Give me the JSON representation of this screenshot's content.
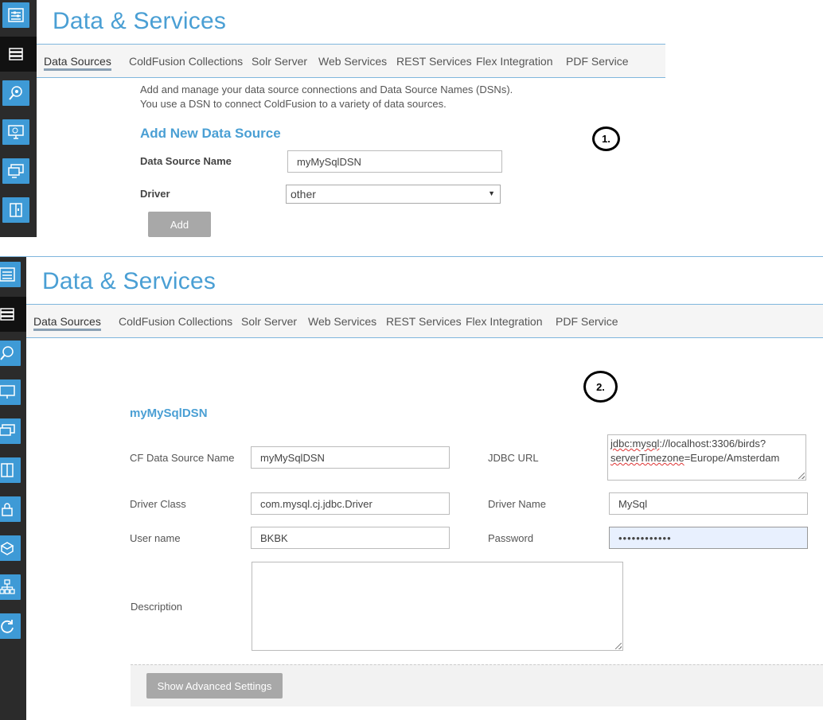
{
  "panel1": {
    "title": "Data & Services",
    "tabs": [
      "Data Sources",
      "ColdFusion Collections",
      "Solr Server",
      "Web Services",
      "REST Services",
      "Flex Integration",
      "PDF Service"
    ],
    "intro_line1": "Add and manage your data source connections and Data Source Names (DSNs).",
    "intro_line2": "You use a DSN to connect ColdFusion to a variety of data sources.",
    "section_title": "Add New Data Source",
    "dsn_label": "Data Source Name",
    "dsn_value": "myMySqlDSN",
    "driver_label": "Driver",
    "driver_value": "other",
    "add_button": "Add",
    "badge": "1."
  },
  "panel2": {
    "title": "Data & Services",
    "tabs": [
      "Data Sources",
      "ColdFusion Collections",
      "Solr Server",
      "Web Services",
      "REST Services",
      "Flex Integration",
      "PDF Service"
    ],
    "badge": "2.",
    "dsn_heading": "myMySqlDSN",
    "cf_dsn_label": "CF Data Source Name",
    "cf_dsn_value": "myMySqlDSN",
    "jdbc_label": "JDBC URL",
    "jdbc_value_line1_a": "jdbc:mysql",
    "jdbc_value_line1_b": "://localhost:3306/birds?",
    "jdbc_value_line2_a": "serverTimezone",
    "jdbc_value_line2_b": "=Europe/Amsterdam",
    "driver_class_label": "Driver Class",
    "driver_class_value": "com.mysql.cj.jdbc.Driver",
    "driver_name_label": "Driver Name",
    "driver_name_value": "MySql",
    "username_label": "User name",
    "username_value": "BKBK",
    "password_label": "Password",
    "password_value": "••••••••••••",
    "description_label": "Description",
    "advanced_button": "Show Advanced Settings"
  },
  "sidebar_icons": [
    "settings-icon",
    "data-services-icon",
    "debugging-icon",
    "server-monitoring-icon",
    "devices-icon",
    "packaging-icon",
    "security-icon",
    "extensions-icon",
    "enterprise-manager-icon",
    "refresh-icon"
  ],
  "colors": {
    "accent": "#4a9fd4",
    "sidebar": "#2b2b2b",
    "icon_bg": "#3e9ad6",
    "button": "#a8a8a8"
  }
}
